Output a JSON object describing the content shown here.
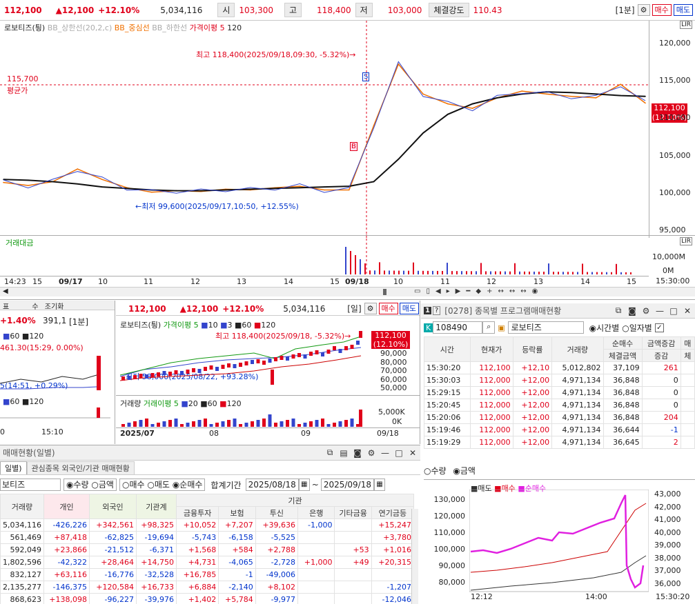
{
  "topbar": {
    "price": "112,100",
    "change": "▲12,100",
    "rate": "+12.10%",
    "volume": "5,034,116",
    "open_label": "시",
    "open": "103,300",
    "high_label": "고",
    "high": "118,400",
    "low_label": "저",
    "low": "103,000",
    "strength_label": "체결강도",
    "strength": "110.43",
    "period": "[1분]",
    "buy": "매수",
    "sell": "매도"
  },
  "main_chart": {
    "legend_name": "로보티즈(틩)",
    "legend_bb_upper": "BB_상한선(20,2,c)",
    "legend_bb_mid": "BB_중심선",
    "legend_bb_lower": "BB_하한선",
    "legend_disparity": "가격이평 5",
    "legend_120": "120",
    "high_note": "최고 118,400(2025/09/18,09:30, -5.32%)→",
    "low_note": "←최저 99,600(2025/09/17,10:50, +12.55%)",
    "avg_price": "115,700",
    "avg_label": "평균가",
    "badge_s": "S",
    "badge_b": "B",
    "cur_price": "112,100",
    "cur_rate": "(12.10%)",
    "y_ticks": [
      "120,000",
      "115,000",
      "110,000",
      "105,000",
      "100,000",
      "95,000"
    ],
    "vol_title": "거래대금",
    "vol_ticks": [
      "10,000M",
      "0M"
    ],
    "x_ticks": [
      "14:23",
      "15",
      "09/17",
      "10",
      "11",
      "12",
      "13",
      "14",
      "15",
      "09/18",
      "10",
      "11",
      "12",
      "13",
      "14",
      "15"
    ],
    "x_end": "15:30:00",
    "tags": [
      "LIR",
      "LIR",
      "LIR"
    ]
  },
  "chart_data": [
    {
      "type": "line",
      "title": "로보티즈(틩)",
      "series": [
        {
          "name": "가격이평 5",
          "values": [
            101400,
            101000,
            101500,
            103200,
            101800,
            100700,
            100100,
            100300,
            100200,
            100500,
            100400,
            100700,
            100900,
            100400,
            100400,
            109000,
            117200,
            113200,
            111900,
            111300,
            112700,
            113600,
            113200,
            112900,
            112700,
            114500,
            112000
          ]
        },
        {
          "name": "120",
          "values": [
            101800,
            101700,
            101500,
            101200,
            100800,
            100600,
            100400,
            100300,
            100300,
            100400,
            100500,
            100600,
            100700,
            100800,
            100900,
            101500,
            104500,
            108000,
            110500,
            111900,
            112700,
            113200,
            113500,
            113400,
            113200,
            113000,
            112900
          ]
        }
      ],
      "x": [
        "14:23",
        "15",
        "09/17",
        "10",
        "11",
        "12",
        "13",
        "14",
        "15",
        "09/18",
        "10",
        "11",
        "12",
        "13",
        "14",
        "15",
        "15:30"
      ],
      "ylim": [
        94000,
        123000
      ],
      "grid": false
    }
  ],
  "left_mini": {
    "rate": "+1.40%",
    "value": "391,1",
    "period": "[1분]",
    "note1": "461.30(15:29, 0.00%)",
    "note2": "5(14:51, +0.29%)",
    "leg": "60",
    "leg2": "120",
    "x1": "0",
    "x2": "15:10",
    "tabs": [
      "표",
      "수",
      "조기화"
    ]
  },
  "daily_chart": {
    "price": "112,100",
    "change": "▲12,100",
    "rate": "+12.10%",
    "volume": "5,034,116",
    "period": "[일]",
    "buy": "매수",
    "sell": "매도",
    "legend_name": "로보티즈(틩)",
    "legend_ma": "가격이평 5",
    "legend_10": "10",
    "legend_3": "3",
    "legend_60": "60",
    "legend_120": "120",
    "high_note": "최고 118,400(2025/09/18, -5.32%)→",
    "low_note": "최저 58,000(2025/08/22, +93.28%)",
    "cur_price": "112,100",
    "cur_rate": "(12.10%)",
    "y_ticks": [
      "90,000",
      "80,000",
      "70,000",
      "60,000",
      "50,000"
    ],
    "vol_legend": "거래량",
    "vol_ma": "거래이평 5",
    "vol_20": "20",
    "vol_60": "60",
    "vol_120": "120",
    "vol_ticks": [
      "5,000K",
      "0K"
    ],
    "x_ticks": [
      "2025/07",
      "08",
      "09",
      "09/18"
    ]
  },
  "program": {
    "title": "[0278] 종목별 프로그램매매현황",
    "code": "108490",
    "name": "로보티즈",
    "radio1": "시간별",
    "radio2": "일자별",
    "headers": [
      "시간",
      "현재가",
      "등락률",
      "거래량",
      "순매수",
      "금액증감",
      "매"
    ],
    "sub_headers": [
      "체결금액",
      "증감",
      "체"
    ],
    "rows": [
      [
        "15:30:20",
        "112,100",
        "+12,10",
        "5,012,802",
        "37,109",
        "261"
      ],
      [
        "15:30:03",
        "112,000",
        "+12,00",
        "4,971,134",
        "36,848",
        "0"
      ],
      [
        "15:29:15",
        "112,000",
        "+12,00",
        "4,971,134",
        "36,848",
        "0"
      ],
      [
        "15:20:45",
        "112,000",
        "+12,00",
        "4,971,134",
        "36,848",
        "0"
      ],
      [
        "15:20:06",
        "112,000",
        "+12,00",
        "4,971,134",
        "36,848",
        "204"
      ],
      [
        "15:19:46",
        "112,000",
        "+12,00",
        "4,971,134",
        "36,644",
        "-1"
      ],
      [
        "15:19:29",
        "112,000",
        "+12,00",
        "4,971,134",
        "36,645",
        "2"
      ]
    ],
    "radio_qty": "수량",
    "radio_amt": "금액",
    "chart_legend": [
      "매도",
      "매수",
      "순매수"
    ],
    "left_ticks": [
      "130,000",
      "120,000",
      "110,000",
      "100,000",
      "90,000",
      "80,000"
    ],
    "right_ticks": [
      "43,000",
      "42,000",
      "41,000",
      "40,000",
      "39,000",
      "38,000",
      "37,000",
      "36,000"
    ],
    "x_ticks": [
      "12:12",
      "14:00",
      "15:30:20"
    ]
  },
  "investor": {
    "title": "매매현황(일별)",
    "tab1": "일별)",
    "tab2": "관심종목 외국인/기관 매매현황",
    "stock": "보티즈",
    "radios": [
      "수량",
      "금액",
      "매수",
      "매도",
      "순매수"
    ],
    "period_label": "합계기간",
    "from": "2025/08/18",
    "tilde": "~",
    "to": "2025/09/18",
    "group_label": "기관",
    "headers": [
      "거래량",
      "개인",
      "외국인",
      "기관계",
      "금융투자",
      "보험",
      "투신",
      "은행",
      "기타금융",
      "연기금등"
    ],
    "rows": [
      [
        "5,034,116",
        "-426,226",
        "+342,561",
        "+98,325",
        "+10,052",
        "+7,207",
        "+39,636",
        "-1,000",
        "",
        "+15,247"
      ],
      [
        "561,469",
        "+87,418",
        "-62,825",
        "-19,694",
        "-5,743",
        "-6,158",
        "-5,525",
        "",
        "",
        "+3,780"
      ],
      [
        "592,049",
        "+23,866",
        "-21,512",
        "-6,371",
        "+1,568",
        "+584",
        "+2,788",
        "",
        "+53",
        "+1,016"
      ],
      [
        "1,802,596",
        "-42,322",
        "+28,464",
        "+14,750",
        "+4,731",
        "-4,065",
        "-2,728",
        "+1,000",
        "+49",
        "+20,315"
      ],
      [
        "832,127",
        "+63,116",
        "-16,776",
        "-32,528",
        "+16,785",
        "-1",
        "-49,006",
        "",
        "",
        ""
      ],
      [
        "2,135,277",
        "-146,375",
        "+120,584",
        "+16,733",
        "+6,884",
        "-2,140",
        "+8,102",
        "",
        "",
        "-1,207"
      ],
      [
        "868,623",
        "+138,098",
        "-96,227",
        "-39,976",
        "+1,402",
        "+5,784",
        "-9,977",
        "",
        "",
        "-12,046"
      ]
    ]
  }
}
